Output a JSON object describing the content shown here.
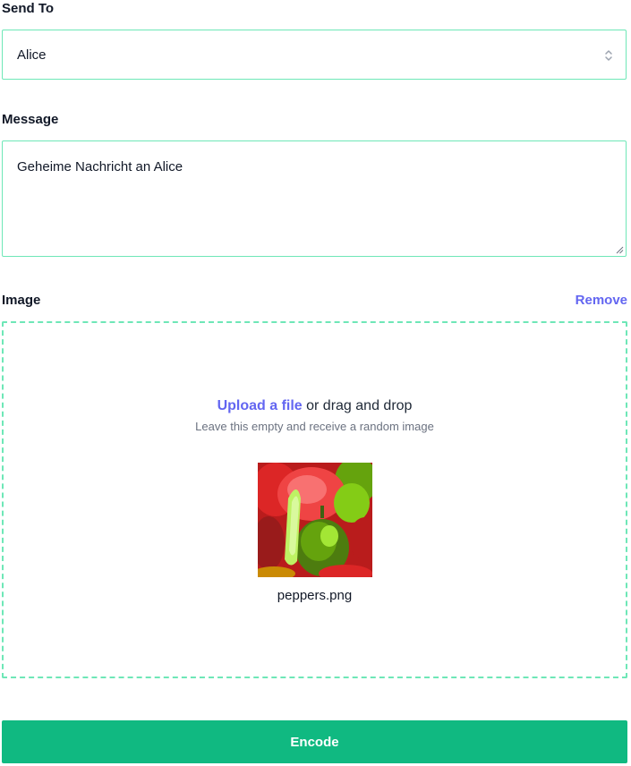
{
  "form": {
    "send_to_label": "Send To",
    "send_to_value": "Alice",
    "message_label": "Message",
    "message_value": "Geheime Nachricht an Alice",
    "image_label": "Image",
    "remove_label": "Remove",
    "upload_link": "Upload a file",
    "upload_rest": " or drag and drop",
    "upload_hint": "Leave this empty and receive a random image",
    "file_name": "peppers.png",
    "encode_label": "Encode"
  },
  "icons": {
    "select": "chevron-up-down-icon",
    "resize": "resize-grip-icon",
    "preview": "peppers-image"
  },
  "colors": {
    "accent": "#10b981",
    "border": "#6ee7b7",
    "link": "#6366f1",
    "hint": "#6b7280"
  }
}
